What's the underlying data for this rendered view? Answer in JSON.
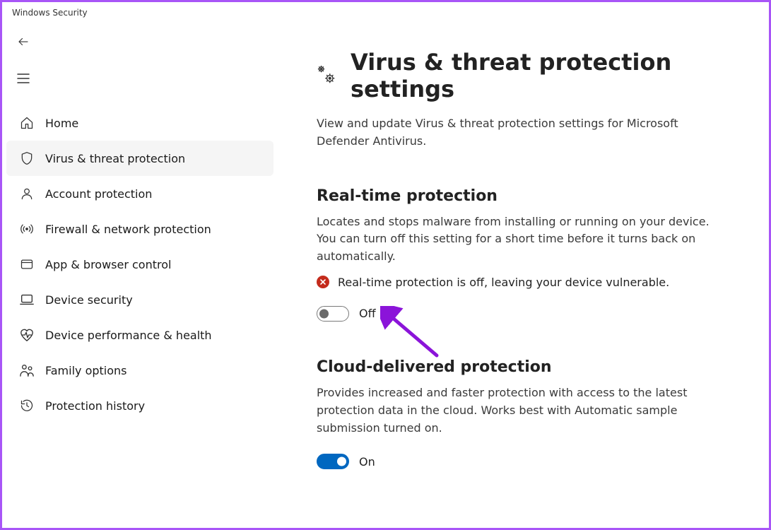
{
  "window_title": "Windows Security",
  "sidebar": {
    "items": [
      {
        "id": "home",
        "label": "Home"
      },
      {
        "id": "virus",
        "label": "Virus & threat protection"
      },
      {
        "id": "account",
        "label": "Account protection"
      },
      {
        "id": "firewall",
        "label": "Firewall & network protection"
      },
      {
        "id": "appbrowser",
        "label": "App & browser control"
      },
      {
        "id": "device",
        "label": "Device security"
      },
      {
        "id": "performance",
        "label": "Device performance & health"
      },
      {
        "id": "family",
        "label": "Family options"
      },
      {
        "id": "history",
        "label": "Protection history"
      }
    ],
    "selected_index": 1
  },
  "page": {
    "title": "Virus & threat protection settings",
    "description": "View and update Virus & threat protection settings for Microsoft Defender Antivirus."
  },
  "section_realtime": {
    "title": "Real-time protection",
    "description": "Locates and stops malware from installing or running on your device. You can turn off this setting for a short time before it turns back on automatically.",
    "warning": "Real-time protection is off, leaving your device vulnerable.",
    "toggle_state": "off",
    "toggle_label": "Off"
  },
  "section_cloud": {
    "title": "Cloud-delivered protection",
    "description": "Provides increased and faster protection with access to the latest protection data in the cloud. Works best with Automatic sample submission turned on.",
    "toggle_state": "on",
    "toggle_label": "On"
  },
  "colors": {
    "accent": "#0067c0",
    "error": "#c42b1c",
    "annotation": "#8b14d9"
  }
}
